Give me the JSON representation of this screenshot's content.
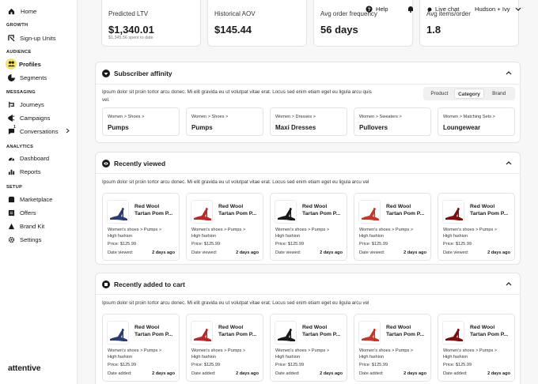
{
  "sidebar": {
    "home": "Home",
    "sections": [
      {
        "title": "GROWTH",
        "items": [
          {
            "label": "Sign-up Units",
            "icon": "signup-icon"
          }
        ]
      },
      {
        "title": "AUDIENCE",
        "items": [
          {
            "label": "Profiles",
            "icon": "profiles-icon",
            "active": true
          },
          {
            "label": "Segments",
            "icon": "segments-icon"
          }
        ]
      },
      {
        "title": "MESSAGING",
        "items": [
          {
            "label": "Journeys",
            "icon": "journeys-icon"
          },
          {
            "label": "Campaigns",
            "icon": "campaigns-icon"
          },
          {
            "label": "Conversations",
            "icon": "conversations-icon",
            "badge": "1",
            "chevron": true
          }
        ]
      },
      {
        "title": "ANALYTICS",
        "items": [
          {
            "label": "Dashboard",
            "icon": "dashboard-icon"
          },
          {
            "label": "Reports",
            "icon": "reports-icon"
          }
        ]
      },
      {
        "title": "SETUP",
        "items": [
          {
            "label": "Marketplace",
            "icon": "marketplace-icon"
          },
          {
            "label": "Offers",
            "icon": "offers-icon"
          },
          {
            "label": "Brand Kit",
            "icon": "brand-kit-icon"
          },
          {
            "label": "Settings",
            "icon": "settings-icon"
          }
        ]
      }
    ],
    "logo": "attentive"
  },
  "topbar": {
    "help": "Help",
    "live_chat": "Live chat",
    "user": "Hudson + Ivy"
  },
  "stats": [
    {
      "label": "Predicted LTV",
      "value": "$1,340.01",
      "sub": "$1,345.56 spent to date"
    },
    {
      "label": "Historical AOV",
      "value": "$145.44",
      "sub": ""
    },
    {
      "label": "Avg order frequency",
      "value": "56 days",
      "sub": ""
    },
    {
      "label": "Avg items/order",
      "value": "1.8",
      "sub": ""
    }
  ],
  "affinity": {
    "title": "Subscriber affinity",
    "desc_line1": "Ipsum dolor sit proin tortor arcu donec. Mi elit gravida eu ut volutpat vitae erat. Locus sed enim etiam eget eu ligula arcu quis",
    "desc_line2": "vel.",
    "tabs": [
      "Product",
      "Category",
      "Brand"
    ],
    "active_tab": "Category",
    "items": [
      {
        "path": "Women  >  Shoes  >",
        "name": "Pumps"
      },
      {
        "path": "Women  >  Shoes  >",
        "name": "Pumps"
      },
      {
        "path": "Women  >  Dresses  >",
        "name": "Maxi Dresses"
      },
      {
        "path": "Women  >  Sweaters  >",
        "name": "Pullovers"
      },
      {
        "path": "Women  >  Matching Sets  >",
        "name": "Loungewear"
      }
    ]
  },
  "recently_viewed": {
    "title": "Recently viewed",
    "desc": "Ipsum dolor sit proin tortor arcu donec. Mi elit gravida eu ut volutpat vitae erat. Locus sed enim etiam eget eu ligula arcu vel",
    "date_label": "Date viewed:",
    "items": [
      {
        "name1": "Red Wool",
        "name2": "Tartan Pom P...",
        "cat1": "Women's shoes > Pumps >",
        "cat2": "High fashion",
        "price": "Price: $125.99",
        "date": "2 days ago",
        "color": "#2b3d6e"
      },
      {
        "name1": "Red Wool",
        "name2": "Tartan Pom P...",
        "cat1": "Women's shoes > Pumps >",
        "cat2": "High fashion",
        "price": "Price: $125.99",
        "date": "2 days ago",
        "color": "#b52a2a"
      },
      {
        "name1": "Red Wool",
        "name2": "Tartan Pom P...",
        "cat1": "Women's shoes > Pumps >",
        "cat2": "High fashion",
        "price": "Price: $125.99",
        "date": "2 days ago",
        "color": "#1a1a1a"
      },
      {
        "name1": "Red Wool",
        "name2": "Tartan Pom P...",
        "cat1": "Women's shoes > Pumps >",
        "cat2": "High fashion",
        "price": "Price: $125.99",
        "date": "2 days ago",
        "color": "#c0392b"
      },
      {
        "name1": "Red Wool",
        "name2": "Tartan Pom P...",
        "cat1": "Women's shoes > Pumps >",
        "cat2": "High fashion",
        "price": "Price: $125.99",
        "date": "2 days ago",
        "color": "#7a1010"
      }
    ]
  },
  "recently_added": {
    "title": "Recently added to cart",
    "desc": "Ipsum dolor sit proin tortor arcu donec. Mi elit gravida eu ut volutpat vitae erat. Locus sed enim etiam eget eu ligula arcu vel",
    "date_label": "Date added:",
    "items": [
      {
        "name1": "Red Wool",
        "name2": "Tartan Pom P...",
        "cat1": "Women's shoes > Pumps >",
        "cat2": "High fashion",
        "price": "Price: $125.99",
        "date": "2 days ago",
        "color": "#2b3d6e"
      },
      {
        "name1": "Red Wool",
        "name2": "Tartan Pom P...",
        "cat1": "Women's shoes > Pumps >",
        "cat2": "High fashion",
        "price": "Price: $125.99",
        "date": "2 days ago",
        "color": "#b52a2a"
      },
      {
        "name1": "Red Wool",
        "name2": "Tartan Pom P...",
        "cat1": "Women's shoes > Pumps >",
        "cat2": "High fashion",
        "price": "Price: $125.99",
        "date": "2 days ago",
        "color": "#1a1a1a"
      },
      {
        "name1": "Red Wool",
        "name2": "Tartan Pom P...",
        "cat1": "Women's shoes > Pumps >",
        "cat2": "High fashion",
        "price": "Price: $125.99",
        "date": "2 days ago",
        "color": "#c0392b"
      },
      {
        "name1": "Red Wool",
        "name2": "Tartan Pom P...",
        "cat1": "Women's shoes > Pumps >",
        "cat2": "High fashion",
        "price": "Price: $125.99",
        "date": "2 days ago",
        "color": "#7a1010"
      }
    ]
  },
  "colors": {
    "accent": "#f4e26a",
    "text": "#1a1a1a",
    "border": "#e3e3e3",
    "bg": "#f7f7f7"
  }
}
